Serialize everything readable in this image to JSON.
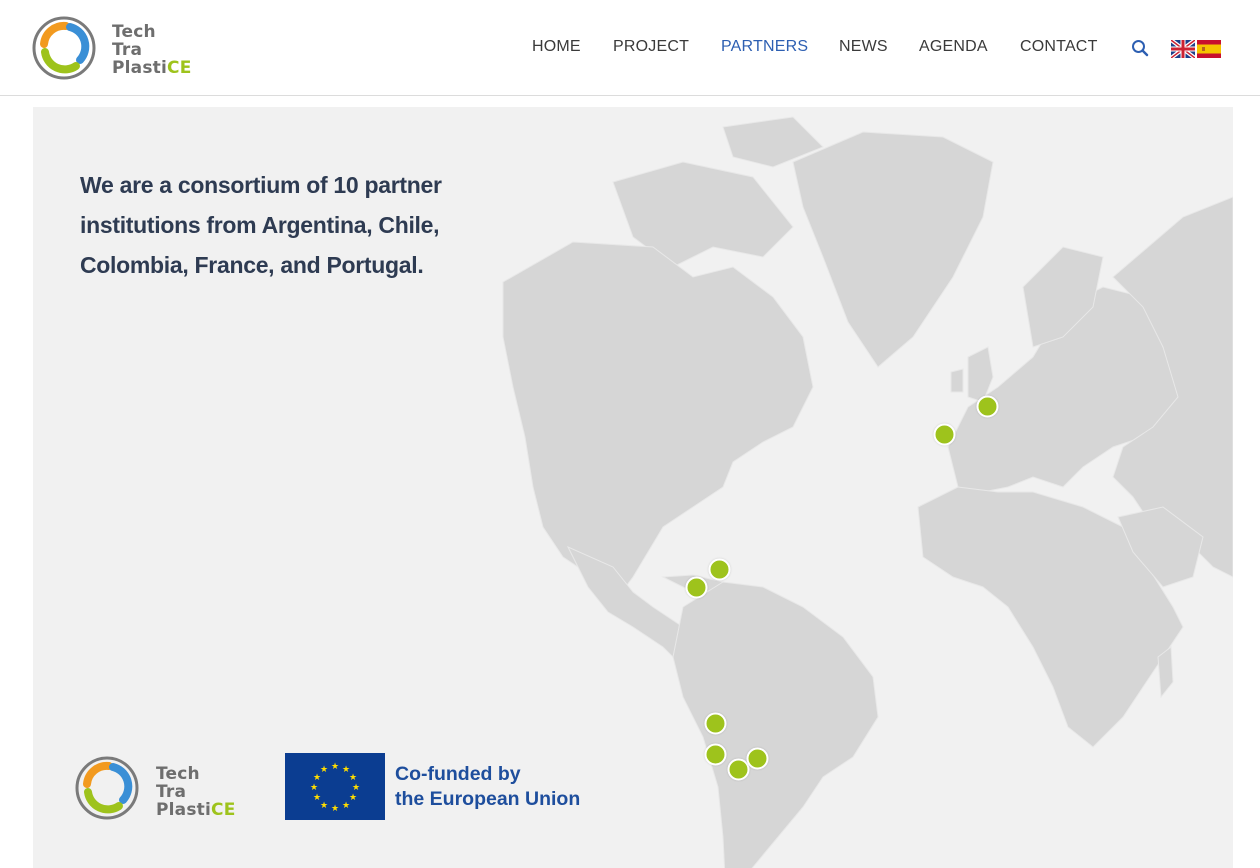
{
  "brand": {
    "logo_line1": "Tech",
    "logo_line2": "Tra",
    "logo_line3a": "Plasti",
    "logo_line3b": "CE",
    "colors": {
      "green": "#9ec31c",
      "blue": "#3a8fd6",
      "orange": "#f29a1f",
      "gray": "#6e6e6e"
    }
  },
  "nav": {
    "items": [
      {
        "label": "HOME",
        "active": false
      },
      {
        "label": "PROJECT",
        "active": false
      },
      {
        "label": "PARTNERS",
        "active": true
      },
      {
        "label": "NEWS",
        "active": false
      },
      {
        "label": "AGENDA",
        "active": false
      },
      {
        "label": "CONTACT",
        "active": false
      }
    ],
    "active_color": "#2d5fb2",
    "search_icon": "search-icon",
    "languages": [
      {
        "name": "english",
        "icon": "uk-flag-icon"
      },
      {
        "name": "spanish",
        "icon": "spain-flag-icon"
      }
    ]
  },
  "hero": {
    "headline": "We are a consortium of 10 partner institutions from Argentina, Chile, Colombia, France, and Portugal.",
    "marker_color": "#9ec31c",
    "map_color": "#d5d5d5"
  },
  "footer_logos": {
    "eu_line1": "Co-funded by",
    "eu_line2": "the European Union",
    "eu_color": "#0b3d91",
    "eu_star_color": "#ffdd00"
  }
}
